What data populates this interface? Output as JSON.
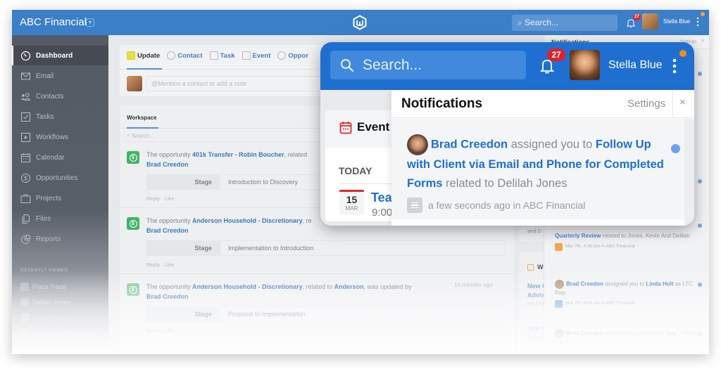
{
  "header": {
    "org_name": "ABC Financial",
    "search_placeholder": "Search...",
    "notification_count": "27",
    "user_name": "Stella Blue"
  },
  "sidebar": {
    "items": [
      {
        "label": "Dashboard",
        "icon": "dashboard-icon",
        "active": true
      },
      {
        "label": "Email",
        "icon": "email-icon"
      },
      {
        "label": "Contacts",
        "icon": "contacts-icon"
      },
      {
        "label": "Tasks",
        "icon": "tasks-icon"
      },
      {
        "label": "Workflows",
        "icon": "workflows-icon"
      },
      {
        "label": "Calendar",
        "icon": "calendar-icon"
      },
      {
        "label": "Opportunities",
        "icon": "opportunities-icon"
      },
      {
        "label": "Projects",
        "icon": "projects-icon"
      },
      {
        "label": "Files",
        "icon": "files-icon"
      },
      {
        "label": "Reports",
        "icon": "reports-icon"
      }
    ],
    "recent_heading": "RECENTLY VIEWED",
    "recent": [
      {
        "label": "Place Trade"
      },
      {
        "label": "Delilah Jones"
      },
      {
        "label": "Debra Palmer"
      },
      {
        "label": "Retirement Planning..."
      }
    ]
  },
  "composer": {
    "tabs": [
      {
        "label": "Update",
        "active": true
      },
      {
        "label": "Contact"
      },
      {
        "label": "Task"
      },
      {
        "label": "Event"
      },
      {
        "label": "Oppor"
      }
    ],
    "placeholder": "@Mention a contact to add a note"
  },
  "workspace": {
    "title": "Workspace",
    "search_placeholder": "Search...",
    "stage_label": "Stage",
    "actions": "Reply · Like",
    "items": [
      {
        "prefix": "The opportunity ",
        "opportunity": "401k Transfer - Robin Boucher",
        "mid": ", related",
        "related": "",
        "suffix": "",
        "user": "Brad Creedon",
        "stage": "Introduction to Discovery",
        "time": ""
      },
      {
        "prefix": "The opportunity ",
        "opportunity": "Anderson Household - Discretionary",
        "mid": ", re",
        "related": "",
        "suffix": "",
        "user": "Brad Creedon",
        "stage": "Implementation to Introduction",
        "time": ""
      },
      {
        "prefix": "The opportunity ",
        "opportunity": "Anderson Household - Discretionary",
        "mid": ", related to ",
        "related": "Anderson",
        "suffix": ", was updated by",
        "user": "Brad Creedon",
        "stage": "Proposal to Implementation",
        "time": "16 minutes ago"
      }
    ]
  },
  "right_column": {
    "and_text": "and D",
    "workflows_title": "Workfl",
    "workflow_items": [
      {
        "line1": "New Clier",
        "line2": "Advisor C",
        "sub": "Re: Delilah"
      },
      {
        "line1": "New Clier",
        "line2": "Advisor C",
        "sub": ""
      }
    ]
  },
  "back_notifications": {
    "title": "Notifications",
    "settings": "Settings",
    "close": "×",
    "items": [
      {
        "lead": "Quarterly Review",
        "rest": " related to Jones, Kevin And Delilah",
        "meta": "Mar 7th, 4:35 pm in ABC Financial",
        "meta_color": "#f0a850"
      },
      {
        "user": "Brad Creedon",
        "rest": " assigned you to ",
        "target": "Linda Holt",
        "tail": " as LTC Rep.",
        "meta": "Mar 7th, 8:00 am in ABC Financial",
        "meta_color": "#7aaee6"
      },
      {
        "user": "Brad Creedon",
        "rest": " replied with a comment \"",
        "target": "Hey ,",
        "tail": " I know that i...\""
      }
    ]
  },
  "popup": {
    "search_placeholder": "Search...",
    "notification_count": "27",
    "user_name": "Stella Blue",
    "events": {
      "title": "Event",
      "today": "TODAY",
      "day": "15",
      "month": "MAR",
      "event_name": "Tea",
      "event_time": "9:00"
    },
    "notifications": {
      "title": "Notifications",
      "settings": "Settings",
      "close": "×",
      "item": {
        "user": "Brad Creedon",
        "action": " assigned you to ",
        "task": "Follow Up with Client via Email and Phone for Completed Forms",
        "related": " related to Delilah Jones",
        "meta": "a few seconds ago in ABC Financial"
      }
    }
  },
  "colors": {
    "brand_blue": "#3b7fc9",
    "popup_blue": "#1f6fd1",
    "badge_red": "#e0202a",
    "success_green": "#3fb463",
    "status_orange": "#f28a1a"
  }
}
